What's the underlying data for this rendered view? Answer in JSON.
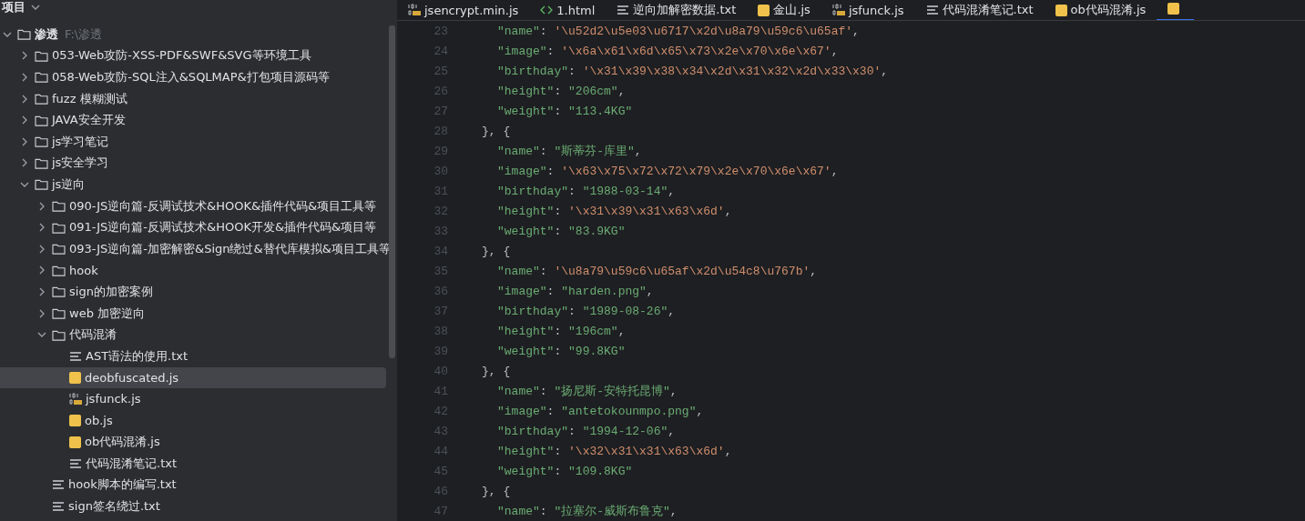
{
  "project_header": {
    "title": "项目"
  },
  "tree": [
    {
      "label": "渗透",
      "path": "F:\\渗透",
      "kind": "folder",
      "expanded": true,
      "selected": false,
      "children": [
        {
          "label": "053-Web攻防-XSS-PDF&SWF&SVG等环境工具",
          "kind": "folder",
          "expanded": false,
          "selected": false
        },
        {
          "label": "058-Web攻防-SQL注入&SQLMAP&打包项目源码等",
          "kind": "folder",
          "expanded": false,
          "selected": false
        },
        {
          "label": "fuzz 模糊测试",
          "kind": "folder",
          "expanded": false,
          "selected": false
        },
        {
          "label": "JAVA安全开发",
          "kind": "folder",
          "expanded": false,
          "selected": false
        },
        {
          "label": "js学习笔记",
          "kind": "folder",
          "expanded": false,
          "selected": false
        },
        {
          "label": "js安全学习",
          "kind": "folder",
          "expanded": false,
          "selected": false
        },
        {
          "label": "js逆向",
          "kind": "folder",
          "expanded": true,
          "selected": false,
          "children": [
            {
              "label": "090-JS逆向篇-反调试技术&HOOK&插件代码&项目工具等",
              "kind": "folder",
              "expanded": false,
              "selected": false
            },
            {
              "label": "091-JS逆向篇-反调试技术&HOOK开发&插件代码&项目等",
              "kind": "folder",
              "expanded": false,
              "selected": false
            },
            {
              "label": "093-JS逆向篇-加密解密&Sign绕过&替代库模拟&项目工具等",
              "kind": "folder",
              "expanded": false,
              "selected": false
            },
            {
              "label": "hook",
              "kind": "folder",
              "expanded": false,
              "selected": false
            },
            {
              "label": "sign的加密案例",
              "kind": "folder",
              "expanded": false,
              "selected": false
            },
            {
              "label": "web 加密逆向",
              "kind": "folder",
              "expanded": false,
              "selected": false
            },
            {
              "label": "代码混淆",
              "kind": "folder",
              "expanded": true,
              "selected": false,
              "children": [
                {
                  "label": "AST语法的使用.txt",
                  "kind": "text",
                  "selected": false
                },
                {
                  "label": "deobfuscated.js",
                  "kind": "js",
                  "selected": true
                },
                {
                  "label": "jsfunck.js",
                  "kind": "binary-js",
                  "selected": false
                },
                {
                  "label": "ob.js",
                  "kind": "js",
                  "selected": false
                },
                {
                  "label": "ob代码混淆.js",
                  "kind": "js",
                  "selected": false
                },
                {
                  "label": "代码混淆笔记.txt",
                  "kind": "text",
                  "selected": false
                }
              ]
            },
            {
              "label": "hook脚本的编写.txt",
              "kind": "text",
              "selected": false
            },
            {
              "label": "sign签名绕过.txt",
              "kind": "text",
              "selected": false
            }
          ]
        }
      ]
    }
  ],
  "tabs": [
    {
      "label": "jsencrypt.min.js",
      "kind": "binary-js",
      "selected": false
    },
    {
      "label": "1.html",
      "kind": "html",
      "selected": false
    },
    {
      "label": "逆向加解密数据.txt",
      "kind": "text",
      "selected": false
    },
    {
      "label": "金山.js",
      "kind": "js",
      "selected": false
    },
    {
      "label": "jsfunck.js",
      "kind": "binary-js",
      "selected": false
    },
    {
      "label": "代码混淆笔记.txt",
      "kind": "text",
      "selected": false
    },
    {
      "label": "ob代码混淆.js",
      "kind": "js",
      "selected": false
    },
    {
      "kind": "js",
      "selected": true
    }
  ],
  "code_lines": [
    {
      "number": "23",
      "kind": "property",
      "key": "\"name\"",
      "sep": ":",
      "value": {
        "kind": "escaped",
        "text": "'\\u52d2\\u5e03\\u6717\\x2d\\u8a79\\u59c6\\u65af'"
      },
      "tail": ","
    },
    {
      "number": "24",
      "kind": "property",
      "key": "\"image\"",
      "sep": ":",
      "value": {
        "kind": "escaped",
        "text": "'\\x6a\\x61\\x6d\\x65\\x73\\x2e\\x70\\x6e\\x67'"
      },
      "tail": ","
    },
    {
      "number": "25",
      "kind": "property",
      "key": "\"birthday\"",
      "sep": ":",
      "value": {
        "kind": "escaped",
        "text": "'\\x31\\x39\\x38\\x34\\x2d\\x31\\x32\\x2d\\x33\\x30'"
      },
      "tail": ","
    },
    {
      "number": "26",
      "kind": "property",
      "key": "\"height\"",
      "sep": ":",
      "value": {
        "kind": "string",
        "text": "\"206cm\""
      },
      "tail": ","
    },
    {
      "number": "27",
      "kind": "property",
      "key": "\"weight\"",
      "sep": ":",
      "value": {
        "kind": "string",
        "text": "\"113.4KG\""
      }
    },
    {
      "number": "28",
      "kind": "brace",
      "text": "}, {"
    },
    {
      "number": "29",
      "kind": "property",
      "key": "\"name\"",
      "sep": ":",
      "value": {
        "kind": "string",
        "text": "\"斯蒂芬-库里\""
      },
      "tail": ","
    },
    {
      "number": "30",
      "kind": "property",
      "key": "\"image\"",
      "sep": ":",
      "value": {
        "kind": "escaped",
        "text": "'\\x63\\x75\\x72\\x72\\x79\\x2e\\x70\\x6e\\x67'"
      },
      "tail": ","
    },
    {
      "number": "31",
      "kind": "property",
      "key": "\"birthday\"",
      "sep": ":",
      "value": {
        "kind": "string",
        "text": "\"1988-03-14\""
      },
      "tail": ","
    },
    {
      "number": "32",
      "kind": "property",
      "key": "\"height\"",
      "sep": ":",
      "value": {
        "kind": "escaped",
        "text": "'\\x31\\x39\\x31\\x63\\x6d'"
      },
      "tail": ","
    },
    {
      "number": "33",
      "kind": "property",
      "key": "\"weight\"",
      "sep": ":",
      "value": {
        "kind": "string",
        "text": "\"83.9KG\""
      }
    },
    {
      "number": "34",
      "kind": "brace",
      "text": "}, {"
    },
    {
      "number": "35",
      "kind": "property",
      "key": "\"name\"",
      "sep": ":",
      "value": {
        "kind": "escaped",
        "text": "'\\u8a79\\u59c6\\u65af\\x2d\\u54c8\\u767b'"
      },
      "tail": ","
    },
    {
      "number": "36",
      "kind": "property",
      "key": "\"image\"",
      "sep": ":",
      "value": {
        "kind": "string",
        "text": "\"harden.png\""
      },
      "tail": ","
    },
    {
      "number": "37",
      "kind": "property",
      "key": "\"birthday\"",
      "sep": ":",
      "value": {
        "kind": "string",
        "text": "\"1989-08-26\""
      },
      "tail": ","
    },
    {
      "number": "38",
      "kind": "property",
      "key": "\"height\"",
      "sep": ":",
      "value": {
        "kind": "string",
        "text": "\"196cm\""
      },
      "tail": ","
    },
    {
      "number": "39",
      "kind": "property",
      "key": "\"weight\"",
      "sep": ":",
      "value": {
        "kind": "string",
        "text": "\"99.8KG\""
      }
    },
    {
      "number": "40",
      "kind": "brace",
      "text": "}, {"
    },
    {
      "number": "41",
      "kind": "property",
      "key": "\"name\"",
      "sep": ":",
      "value": {
        "kind": "string",
        "text": "\"扬尼斯-安特托昆博\""
      },
      "tail": ","
    },
    {
      "number": "42",
      "kind": "property",
      "key": "\"image\"",
      "sep": ":",
      "value": {
        "kind": "string",
        "text": "\"antetokounmpo.png\""
      },
      "tail": ","
    },
    {
      "number": "43",
      "kind": "property",
      "key": "\"birthday\"",
      "sep": ":",
      "value": {
        "kind": "string",
        "text": "\"1994-12-06\""
      },
      "tail": ","
    },
    {
      "number": "44",
      "kind": "property",
      "key": "\"height\"",
      "sep": ":",
      "value": {
        "kind": "escaped",
        "text": "'\\x32\\x31\\x31\\x63\\x6d'"
      },
      "tail": ","
    },
    {
      "number": "45",
      "kind": "property",
      "key": "\"weight\"",
      "sep": ":",
      "value": {
        "kind": "string",
        "text": "\"109.8KG\""
      }
    },
    {
      "number": "46",
      "kind": "brace",
      "text": "}, {"
    },
    {
      "number": "47",
      "kind": "property",
      "key": "\"name\"",
      "sep": ":",
      "value": {
        "kind": "string",
        "text": "\"拉塞尔-威斯布鲁克\""
      },
      "tail": ","
    }
  ]
}
